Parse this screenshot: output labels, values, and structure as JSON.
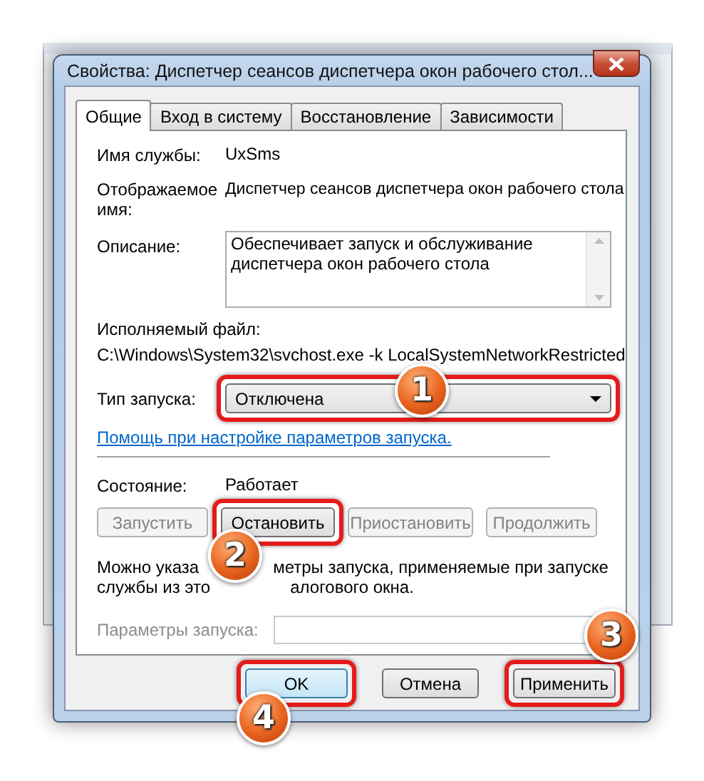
{
  "window": {
    "title": "Свойства: Диспетчер сеансов диспетчера окон рабочего стол..."
  },
  "tabs": [
    {
      "label": "Общие",
      "selected": true
    },
    {
      "label": "Вход в систему",
      "selected": false
    },
    {
      "label": "Восстановление",
      "selected": false
    },
    {
      "label": "Зависимости",
      "selected": false
    }
  ],
  "service_name": {
    "label": "Имя службы:",
    "value": "UxSms"
  },
  "display_name": {
    "label": "Отображаемое имя:",
    "value": "Диспетчер сеансов диспетчера окон рабочего стола"
  },
  "description": {
    "label": "Описание:",
    "value": "Обеспечивает запуск и обслуживание диспетчера окон рабочего стола"
  },
  "executable": {
    "label": "Исполняемый файл:",
    "value": "C:\\Windows\\System32\\svchost.exe -k LocalSystemNetworkRestricted"
  },
  "startup_type": {
    "label": "Тип запуска:",
    "value": "Отключена",
    "highlighted": true
  },
  "help_link": "Помощь при настройке параметров запуска.",
  "status": {
    "label": "Состояние:",
    "value": "Работает"
  },
  "service_buttons": [
    {
      "label": "Запустить",
      "disabled": true,
      "highlighted": false
    },
    {
      "label": "Остановить",
      "disabled": false,
      "highlighted": true
    },
    {
      "label": "Приостановить",
      "disabled": true,
      "highlighted": false
    },
    {
      "label": "Продолжить",
      "disabled": true,
      "highlighted": false
    }
  ],
  "note_fragments": [
    "Можно указа",
    "метры запуска, применяемые при запуске",
    "службы из это",
    "алогового окна."
  ],
  "start_params": {
    "label": "Параметры запуска:",
    "disabled": true
  },
  "footer_buttons": [
    {
      "label": "OK",
      "default": true,
      "highlighted": true
    },
    {
      "label": "Отмена",
      "default": false,
      "highlighted": false
    },
    {
      "label": "Применить",
      "default": false,
      "highlighted": true
    }
  ],
  "callouts": [
    {
      "number": "1"
    },
    {
      "number": "2"
    },
    {
      "number": "3"
    },
    {
      "number": "4"
    }
  ]
}
